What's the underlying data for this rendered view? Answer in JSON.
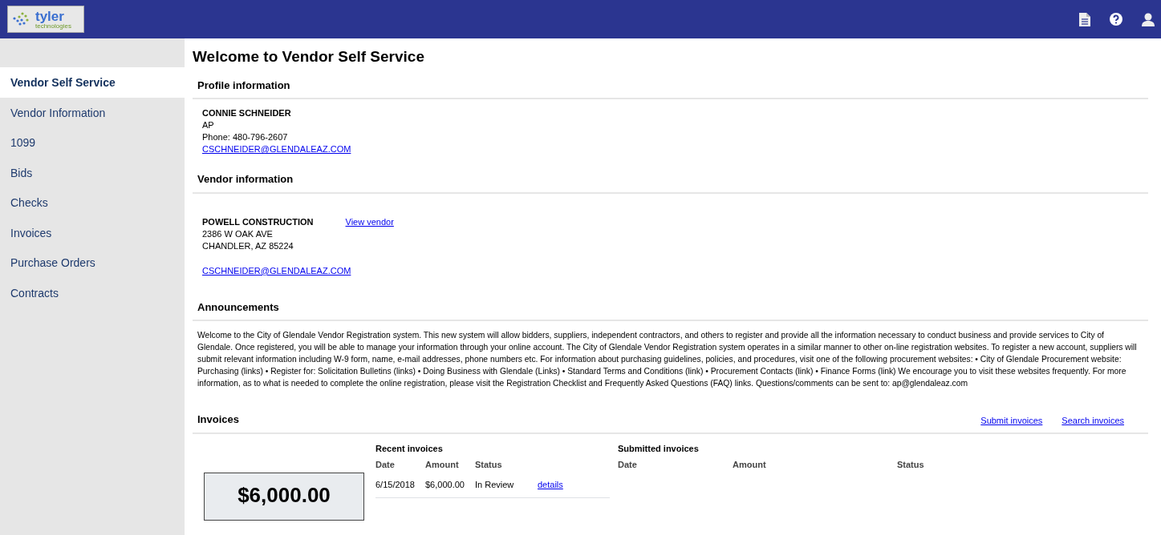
{
  "header": {
    "logo": {
      "name": "tyler",
      "tagline": "technologies"
    }
  },
  "sidebar": {
    "items": [
      {
        "label": "Vendor Self Service",
        "selected": true
      },
      {
        "label": "Vendor Information",
        "selected": false
      },
      {
        "label": "1099",
        "selected": false
      },
      {
        "label": "Bids",
        "selected": false
      },
      {
        "label": "Checks",
        "selected": false
      },
      {
        "label": "Invoices",
        "selected": false
      },
      {
        "label": "Purchase Orders",
        "selected": false
      },
      {
        "label": "Contracts",
        "selected": false
      }
    ]
  },
  "page_title": "Welcome to Vendor Self Service",
  "profile": {
    "heading": "Profile information",
    "name": "CONNIE SCHNEIDER",
    "role": "AP",
    "phone": "Phone: 480-796-2607",
    "email": "CSCHNEIDER@GLENDALEAZ.COM"
  },
  "vendor": {
    "heading": "Vendor information",
    "name": "POWELL CONSTRUCTION",
    "link": "View vendor",
    "address": [
      "2386 W OAK AVE",
      "CHANDLER, AZ 85224"
    ],
    "email": "CSCHNEIDER@GLENDALEAZ.COM"
  },
  "announcements": {
    "heading": "Announcements",
    "text": "Welcome to the City of Glendale Vendor Registration system. This new system will allow bidders, suppliers, independent contractors, and others to register and provide all the information necessary to conduct business and provide services to City of Glendale. Once registered, you will be able to manage your information through your online account. The City of Glendale Vendor Registration system operates in a similar manner to other on-line registration websites. To register a new account, suppliers will submit relevant information including W-9 form, name, e-mail addresses, phone numbers etc. For information about purchasing guidelines, policies, and procedures, visit one of the following procurement websites: • City of Glendale Procurement website: Purchasing (links) • Register for: Solicitation Bulletins (links) • Doing Business with Glendale (Links) • Standard Terms and Conditions (link) • Procurement Contacts (link) • Finance Forms (link) We encourage you to visit these websites frequently. For more information, as to what is needed to complete the online registration, please visit the Registration Checklist and Frequently Asked Questions (FAQ) links. Questions/comments can be sent to: ap@glendaleaz.com"
  },
  "invoices": {
    "heading": "Invoices",
    "links": [
      "Submit invoices",
      "Search invoices"
    ],
    "total": "$6,000.00",
    "recent": {
      "title": "Recent invoices",
      "columns": [
        "Date",
        "Amount",
        "Status"
      ],
      "rows": [
        {
          "date": "6/15/2018",
          "amount": "$6,000.00",
          "status": "In Review",
          "link": "details"
        }
      ]
    },
    "submitted": {
      "title": "Submitted invoices",
      "columns": [
        "Date",
        "Amount",
        "Status"
      ]
    }
  }
}
